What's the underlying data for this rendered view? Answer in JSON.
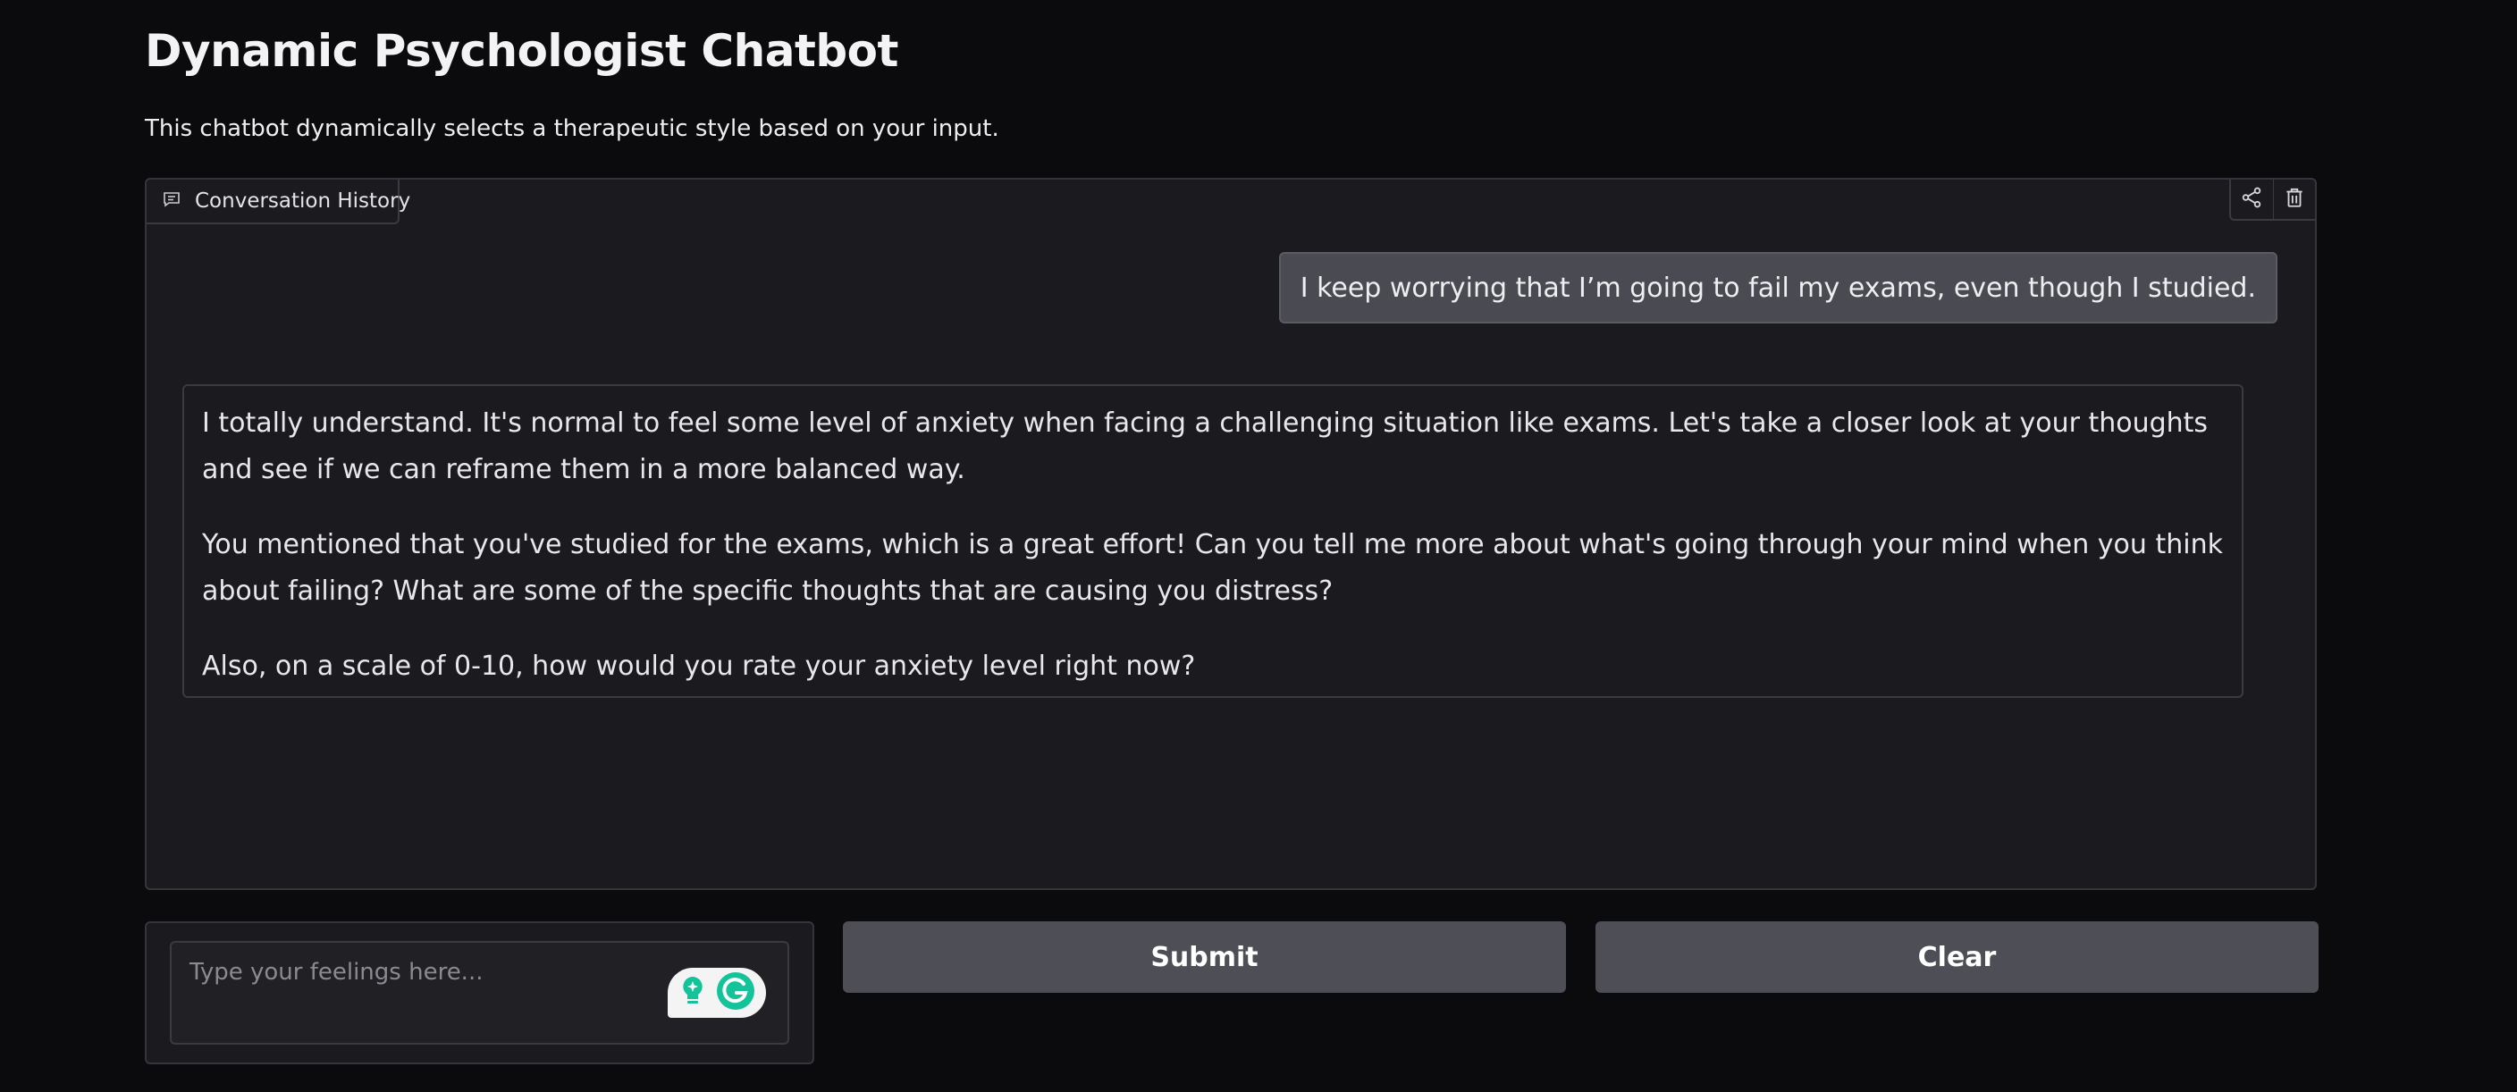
{
  "header": {
    "title": "Dynamic Psychologist Chatbot",
    "subtitle": "This chatbot dynamically selects a therapeutic style based on your input."
  },
  "chatbot": {
    "label": "Conversation History",
    "label_icon": "chat-bubble-icon",
    "tools": [
      {
        "name": "share",
        "icon": "share-icon"
      },
      {
        "name": "clear-history",
        "icon": "trash-icon"
      }
    ],
    "messages": [
      {
        "role": "user",
        "text": "I keep worrying that I’m going to fail my exams, even though I studied."
      },
      {
        "role": "assistant",
        "paragraphs": [
          "I totally understand. It's normal to feel some level of anxiety when facing a challenging situation like exams. Let's take a closer look at your thoughts and see if we can reframe them in a more balanced way.",
          "You mentioned that you've studied for the exams, which is a great effort! Can you tell me more about what's going through your mind when you think about failing? What are some of the specific thoughts that are causing you distress?",
          "Also, on a scale of 0-10, how would you rate your anxiety level right now?"
        ]
      }
    ]
  },
  "input": {
    "placeholder": "Type your feelings here...",
    "value": "",
    "extension_icons": [
      "grammarly-assist-icon",
      "grammarly-logo-icon"
    ]
  },
  "buttons": {
    "submit_label": "Submit",
    "clear_label": "Clear"
  },
  "colors": {
    "background": "#0b0b0d",
    "panel": "#1b1b1f",
    "user_bubble": "#4a4b52",
    "button": "#4e4f56",
    "grammarly_green": "#15c39a"
  }
}
